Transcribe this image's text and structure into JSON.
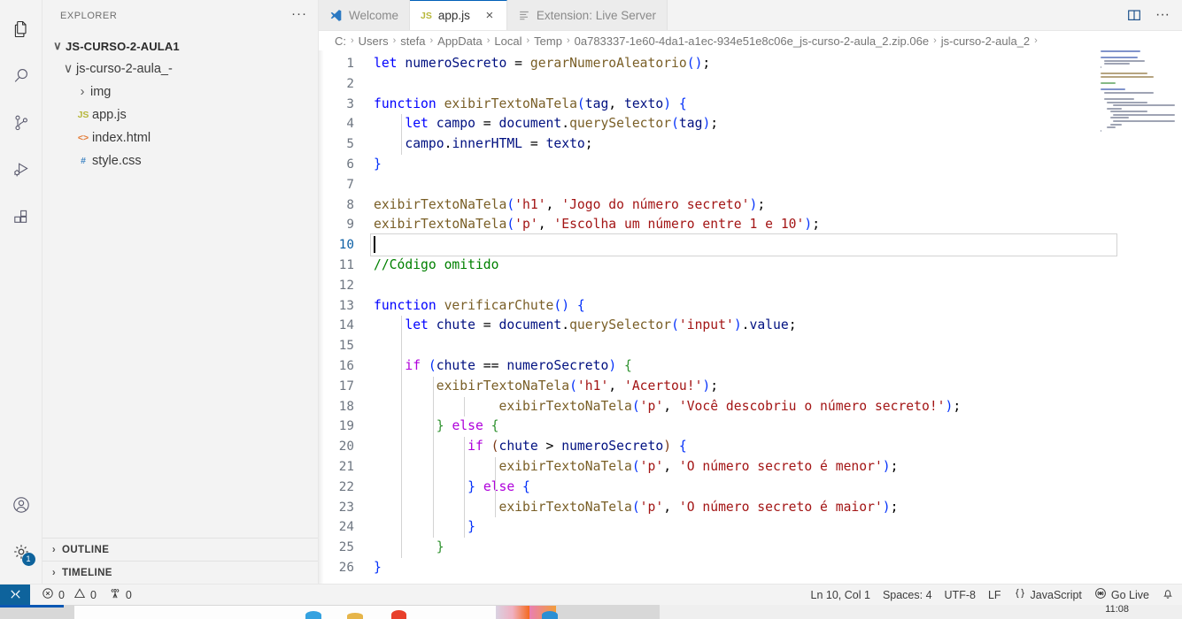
{
  "activitybar": {
    "items": [
      {
        "name": "explorer",
        "icon": "files-icon",
        "active": true
      },
      {
        "name": "search",
        "icon": "search-icon",
        "active": false
      },
      {
        "name": "source-control",
        "icon": "source-control-icon",
        "active": false
      },
      {
        "name": "run-and-debug",
        "icon": "run-debug-icon",
        "active": false
      },
      {
        "name": "extensions",
        "icon": "extensions-icon",
        "active": false
      }
    ],
    "bottom": [
      {
        "name": "accounts",
        "icon": "account-icon",
        "badge": ""
      },
      {
        "name": "manage",
        "icon": "gear-icon",
        "badge": "1"
      }
    ]
  },
  "sidebar": {
    "title": "EXPLORER",
    "more_actions": "···",
    "tree": [
      {
        "label": "JS-CURSO-2-AULA1",
        "level": "root",
        "chevron": "∨",
        "icon": "",
        "icon_class": ""
      },
      {
        "label": "js-curso-2-aula_-",
        "level": "lvl1",
        "chevron": "∨",
        "icon": "",
        "icon_class": ""
      },
      {
        "label": "img",
        "level": "lvl2",
        "chevron": "›",
        "icon": "",
        "icon_class": ""
      },
      {
        "label": "app.js",
        "level": "lvl2",
        "chevron": "",
        "icon": "JS",
        "icon_class": "icon-js"
      },
      {
        "label": "index.html",
        "level": "lvl2",
        "chevron": "",
        "icon": "<>",
        "icon_class": "icon-html"
      },
      {
        "label": "style.css",
        "level": "lvl2",
        "chevron": "",
        "icon": "#",
        "icon_class": "icon-css"
      }
    ],
    "panels": [
      {
        "label": "OUTLINE",
        "chevron": "›"
      },
      {
        "label": "TIMELINE",
        "chevron": "›"
      }
    ]
  },
  "tabs": [
    {
      "label": "Welcome",
      "icon": "vscode-logo-icon",
      "active": false,
      "closable": false
    },
    {
      "label": "app.js",
      "icon": "js-file-icon",
      "active": true,
      "closable": true,
      "close": "×"
    },
    {
      "label": "Extension: Live Server",
      "icon": "extension-icon",
      "active": false,
      "closable": false
    }
  ],
  "editor_actions": [
    {
      "name": "split-editor-right",
      "icon": "split-editor-icon"
    },
    {
      "name": "more-actions",
      "icon": "ellipsis-icon",
      "label": "···"
    }
  ],
  "breadcrumbs": [
    "C:",
    "Users",
    "stefa",
    "AppData",
    "Local",
    "Temp",
    "0a783337-1e60-4da1-a1ec-934e51e8c06e_js-curso-2-aula_2.zip.06e",
    "js-curso-2-aula_2",
    ""
  ],
  "editor": {
    "language": "JavaScript",
    "active_line": 10,
    "lines": [
      {
        "n": 1,
        "tokens": [
          {
            "t": "let ",
            "c": "t-kw"
          },
          {
            "t": "numeroSecreto",
            "c": "t-var"
          },
          {
            "t": " = ",
            "c": "t-op"
          },
          {
            "t": "gerarNumeroAleatorio",
            "c": "t-fn"
          },
          {
            "t": "(",
            "c": "t-p1"
          },
          {
            "t": ")",
            "c": "t-p1"
          },
          {
            "t": ";",
            "c": "t-op"
          }
        ]
      },
      {
        "n": 2,
        "tokens": []
      },
      {
        "n": 3,
        "tokens": [
          {
            "t": "function ",
            "c": "t-kw"
          },
          {
            "t": "exibirTextoNaTela",
            "c": "t-fn"
          },
          {
            "t": "(",
            "c": "t-p1"
          },
          {
            "t": "tag",
            "c": "t-var"
          },
          {
            "t": ", ",
            "c": "t-op"
          },
          {
            "t": "texto",
            "c": "t-var"
          },
          {
            "t": ")",
            "c": "t-p1"
          },
          {
            "t": " ",
            "c": "t-op"
          },
          {
            "t": "{",
            "c": "t-p1"
          }
        ]
      },
      {
        "n": 4,
        "tokens": [
          {
            "t": "    ",
            "c": "t-op"
          },
          {
            "t": "let ",
            "c": "t-kw"
          },
          {
            "t": "campo",
            "c": "t-var"
          },
          {
            "t": " = ",
            "c": "t-op"
          },
          {
            "t": "document",
            "c": "t-var"
          },
          {
            "t": ".",
            "c": "t-op"
          },
          {
            "t": "querySelector",
            "c": "t-fn"
          },
          {
            "t": "(",
            "c": "t-p1"
          },
          {
            "t": "tag",
            "c": "t-var"
          },
          {
            "t": ")",
            "c": "t-p1"
          },
          {
            "t": ";",
            "c": "t-op"
          }
        ]
      },
      {
        "n": 5,
        "tokens": [
          {
            "t": "    ",
            "c": "t-op"
          },
          {
            "t": "campo",
            "c": "t-var"
          },
          {
            "t": ".",
            "c": "t-op"
          },
          {
            "t": "innerHTML",
            "c": "t-var"
          },
          {
            "t": " = ",
            "c": "t-op"
          },
          {
            "t": "texto",
            "c": "t-var"
          },
          {
            "t": ";",
            "c": "t-op"
          }
        ]
      },
      {
        "n": 6,
        "tokens": [
          {
            "t": "}",
            "c": "t-p1"
          }
        ]
      },
      {
        "n": 7,
        "tokens": []
      },
      {
        "n": 8,
        "tokens": [
          {
            "t": "exibirTextoNaTela",
            "c": "t-fn"
          },
          {
            "t": "(",
            "c": "t-p1"
          },
          {
            "t": "'h1'",
            "c": "t-str"
          },
          {
            "t": ", ",
            "c": "t-op"
          },
          {
            "t": "'Jogo do número secreto'",
            "c": "t-str"
          },
          {
            "t": ")",
            "c": "t-p1"
          },
          {
            "t": ";",
            "c": "t-op"
          }
        ]
      },
      {
        "n": 9,
        "tokens": [
          {
            "t": "exibirTextoNaTela",
            "c": "t-fn"
          },
          {
            "t": "(",
            "c": "t-p1"
          },
          {
            "t": "'p'",
            "c": "t-str"
          },
          {
            "t": ", ",
            "c": "t-op"
          },
          {
            "t": "'Escolha um número entre 1 e 10'",
            "c": "t-str"
          },
          {
            "t": ")",
            "c": "t-p1"
          },
          {
            "t": ";",
            "c": "t-op"
          }
        ]
      },
      {
        "n": 10,
        "tokens": []
      },
      {
        "n": 11,
        "tokens": [
          {
            "t": "//Código omitido",
            "c": "t-cmt"
          }
        ]
      },
      {
        "n": 12,
        "tokens": []
      },
      {
        "n": 13,
        "tokens": [
          {
            "t": "function ",
            "c": "t-kw"
          },
          {
            "t": "verificarChute",
            "c": "t-fn"
          },
          {
            "t": "(",
            "c": "t-p1"
          },
          {
            "t": ")",
            "c": "t-p1"
          },
          {
            "t": " ",
            "c": "t-op"
          },
          {
            "t": "{",
            "c": "t-p1"
          }
        ]
      },
      {
        "n": 14,
        "tokens": [
          {
            "t": "    ",
            "c": "t-op"
          },
          {
            "t": "let ",
            "c": "t-kw"
          },
          {
            "t": "chute",
            "c": "t-var"
          },
          {
            "t": " = ",
            "c": "t-op"
          },
          {
            "t": "document",
            "c": "t-var"
          },
          {
            "t": ".",
            "c": "t-op"
          },
          {
            "t": "querySelector",
            "c": "t-fn"
          },
          {
            "t": "(",
            "c": "t-p1"
          },
          {
            "t": "'input'",
            "c": "t-str"
          },
          {
            "t": ")",
            "c": "t-p1"
          },
          {
            "t": ".",
            "c": "t-op"
          },
          {
            "t": "value",
            "c": "t-var"
          },
          {
            "t": ";",
            "c": "t-op"
          }
        ]
      },
      {
        "n": 15,
        "tokens": []
      },
      {
        "n": 16,
        "tokens": [
          {
            "t": "    ",
            "c": "t-op"
          },
          {
            "t": "if ",
            "c": "t-ctl"
          },
          {
            "t": "(",
            "c": "t-p1"
          },
          {
            "t": "chute",
            "c": "t-var"
          },
          {
            "t": " == ",
            "c": "t-op"
          },
          {
            "t": "numeroSecreto",
            "c": "t-var"
          },
          {
            "t": ")",
            "c": "t-p1"
          },
          {
            "t": " ",
            "c": "t-op"
          },
          {
            "t": "{",
            "c": "t-p2"
          }
        ]
      },
      {
        "n": 17,
        "tokens": [
          {
            "t": "        ",
            "c": "t-op"
          },
          {
            "t": "exibirTextoNaTela",
            "c": "t-fn"
          },
          {
            "t": "(",
            "c": "t-p1"
          },
          {
            "t": "'h1'",
            "c": "t-str"
          },
          {
            "t": ", ",
            "c": "t-op"
          },
          {
            "t": "'Acertou!'",
            "c": "t-str"
          },
          {
            "t": ")",
            "c": "t-p1"
          },
          {
            "t": ";",
            "c": "t-op"
          }
        ]
      },
      {
        "n": 18,
        "tokens": [
          {
            "t": "                ",
            "c": "t-op"
          },
          {
            "t": "exibirTextoNaTela",
            "c": "t-fn"
          },
          {
            "t": "(",
            "c": "t-p1"
          },
          {
            "t": "'p'",
            "c": "t-str"
          },
          {
            "t": ", ",
            "c": "t-op"
          },
          {
            "t": "'Você descobriu o número secreto!'",
            "c": "t-str"
          },
          {
            "t": ")",
            "c": "t-p1"
          },
          {
            "t": ";",
            "c": "t-op"
          }
        ]
      },
      {
        "n": 19,
        "tokens": [
          {
            "t": "        ",
            "c": "t-op"
          },
          {
            "t": "}",
            "c": "t-p2"
          },
          {
            "t": " ",
            "c": "t-op"
          },
          {
            "t": "else ",
            "c": "t-ctl"
          },
          {
            "t": "{",
            "c": "t-p2"
          }
        ]
      },
      {
        "n": 20,
        "tokens": [
          {
            "t": "            ",
            "c": "t-op"
          },
          {
            "t": "if ",
            "c": "t-ctl"
          },
          {
            "t": "(",
            "c": "t-p3"
          },
          {
            "t": "chute",
            "c": "t-var"
          },
          {
            "t": " > ",
            "c": "t-op"
          },
          {
            "t": "numeroSecreto",
            "c": "t-var"
          },
          {
            "t": ")",
            "c": "t-p3"
          },
          {
            "t": " ",
            "c": "t-op"
          },
          {
            "t": "{",
            "c": "t-p1"
          }
        ]
      },
      {
        "n": 21,
        "tokens": [
          {
            "t": "                ",
            "c": "t-op"
          },
          {
            "t": "exibirTextoNaTela",
            "c": "t-fn"
          },
          {
            "t": "(",
            "c": "t-p1"
          },
          {
            "t": "'p'",
            "c": "t-str"
          },
          {
            "t": ", ",
            "c": "t-op"
          },
          {
            "t": "'O número secreto é menor'",
            "c": "t-str"
          },
          {
            "t": ")",
            "c": "t-p1"
          },
          {
            "t": ";",
            "c": "t-op"
          }
        ]
      },
      {
        "n": 22,
        "tokens": [
          {
            "t": "            ",
            "c": "t-op"
          },
          {
            "t": "}",
            "c": "t-p1"
          },
          {
            "t": " ",
            "c": "t-op"
          },
          {
            "t": "else ",
            "c": "t-ctl"
          },
          {
            "t": "{",
            "c": "t-p1"
          }
        ]
      },
      {
        "n": 23,
        "tokens": [
          {
            "t": "                ",
            "c": "t-op"
          },
          {
            "t": "exibirTextoNaTela",
            "c": "t-fn"
          },
          {
            "t": "(",
            "c": "t-p1"
          },
          {
            "t": "'p'",
            "c": "t-str"
          },
          {
            "t": ", ",
            "c": "t-op"
          },
          {
            "t": "'O número secreto é maior'",
            "c": "t-str"
          },
          {
            "t": ")",
            "c": "t-p1"
          },
          {
            "t": ";",
            "c": "t-op"
          }
        ]
      },
      {
        "n": 24,
        "tokens": [
          {
            "t": "            ",
            "c": "t-op"
          },
          {
            "t": "}",
            "c": "t-p1"
          }
        ]
      },
      {
        "n": 25,
        "tokens": [
          {
            "t": "        ",
            "c": "t-op"
          },
          {
            "t": "}",
            "c": "t-p2"
          }
        ]
      },
      {
        "n": 26,
        "tokens": [
          {
            "t": "}",
            "c": "t-p1"
          }
        ]
      }
    ]
  },
  "statusbar": {
    "remote_icon": "remote-window-icon",
    "left": [
      {
        "name": "problems",
        "icon": "error-icon",
        "text": "0",
        "icon2": "warning-icon",
        "text2": "0"
      },
      {
        "name": "ports",
        "icon": "radio-tower-icon",
        "text": "0"
      }
    ],
    "errors": "0",
    "warnings": "0",
    "ports": "0",
    "right": [
      {
        "name": "editor-position",
        "label": "Ln 10, Col 1"
      },
      {
        "name": "indentation",
        "label": "Spaces: 4"
      },
      {
        "name": "encoding",
        "label": "UTF-8"
      },
      {
        "name": "eol",
        "label": "LF"
      },
      {
        "name": "language-mode",
        "label": "JavaScript",
        "icon": "braces-icon"
      },
      {
        "name": "go-live",
        "label": "Go Live",
        "icon": "broadcast-icon"
      },
      {
        "name": "notifications",
        "label": "",
        "icon": "bell-icon"
      }
    ]
  },
  "taskbar": {
    "clock": "11:08"
  },
  "colors": {
    "accent": "#005fb8",
    "badge": "#0e639c",
    "keyword": "#0000ff",
    "control": "#af00db",
    "function": "#795e26",
    "string": "#a31515",
    "comment": "#008000",
    "variable": "#001080",
    "sidebar_bg": "#f3f3f3",
    "editor_bg": "#ffffff"
  }
}
